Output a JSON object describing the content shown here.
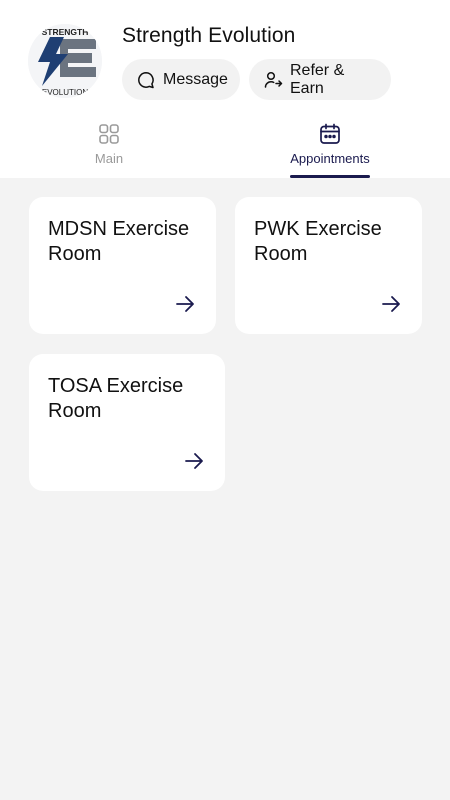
{
  "header": {
    "studio_name": "Strength Evolution",
    "logo": {
      "icon": "strength-evolution-logo",
      "top_text": "STRENGTH",
      "bottom_text": "EVOLUTION"
    },
    "actions": [
      {
        "label": "Message",
        "icon": "chat-bubble-icon"
      },
      {
        "label": "Refer & Earn",
        "icon": "user-share-icon"
      }
    ]
  },
  "tabs": [
    {
      "label": "Main",
      "icon": "grid-icon",
      "active": false
    },
    {
      "label": "Appointments",
      "icon": "calendar-icon",
      "active": true
    }
  ],
  "locations": [
    {
      "name": "MDSN Exercise Room",
      "icon": "arrow-right-icon"
    },
    {
      "name": "PWK Exercise Room",
      "icon": "arrow-right-icon"
    },
    {
      "name": "TOSA Exercise Room",
      "icon": "arrow-right-icon"
    }
  ],
  "colors": {
    "accent": "#1a1a4e",
    "background": "#f3f3f3",
    "card": "#ffffff",
    "pill": "#f2f2f2",
    "inactive_tab": "#9a9a9a",
    "logo_blue": "#1f3f73",
    "logo_gray": "#6b7480"
  }
}
